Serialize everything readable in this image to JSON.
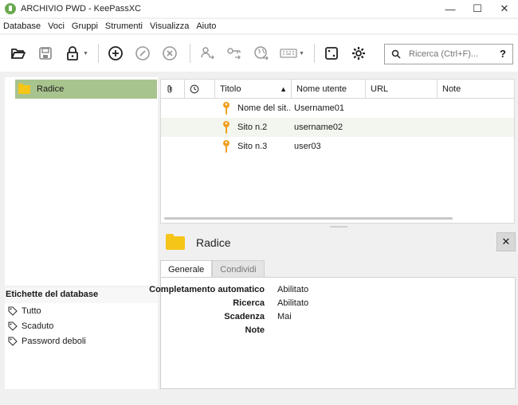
{
  "window": {
    "title": "ARCHIVIO PWD - KeePassXC"
  },
  "menu": [
    "Database",
    "Voci",
    "Gruppi",
    "Strumenti",
    "Visualizza",
    "Aiuto"
  ],
  "search": {
    "placeholder": "Ricerca (Ctrl+F)...",
    "help_label": "?"
  },
  "groups": {
    "root": "Radice"
  },
  "tags": {
    "header": "Etichette del database",
    "items": [
      "Tutto",
      "Scaduto",
      "Password deboli"
    ]
  },
  "entries": {
    "columns": {
      "title": "Titolo",
      "username": "Nome utente",
      "url": "URL",
      "notes": "Note"
    },
    "rows": [
      {
        "title": "Nome del sit...",
        "username": "Username01"
      },
      {
        "title": "Sito n.2",
        "username": "username02"
      },
      {
        "title": "Sito n.3",
        "username": "user03"
      }
    ]
  },
  "details": {
    "title": "Radice",
    "close_label": "✕",
    "tabs": [
      "Generale",
      "Condividi"
    ],
    "fields": [
      {
        "label": "Completamento automatico",
        "value": "Abilitato"
      },
      {
        "label": "Ricerca",
        "value": "Abilitato"
      },
      {
        "label": "Scadenza",
        "value": "Mai"
      },
      {
        "label": "Note",
        "value": ""
      }
    ]
  },
  "colors": {
    "accent_green": "#a8c48e",
    "row_alt": "#f2f6ee",
    "key_orange": "#f0a020",
    "folder_yellow": "#f5c518"
  }
}
